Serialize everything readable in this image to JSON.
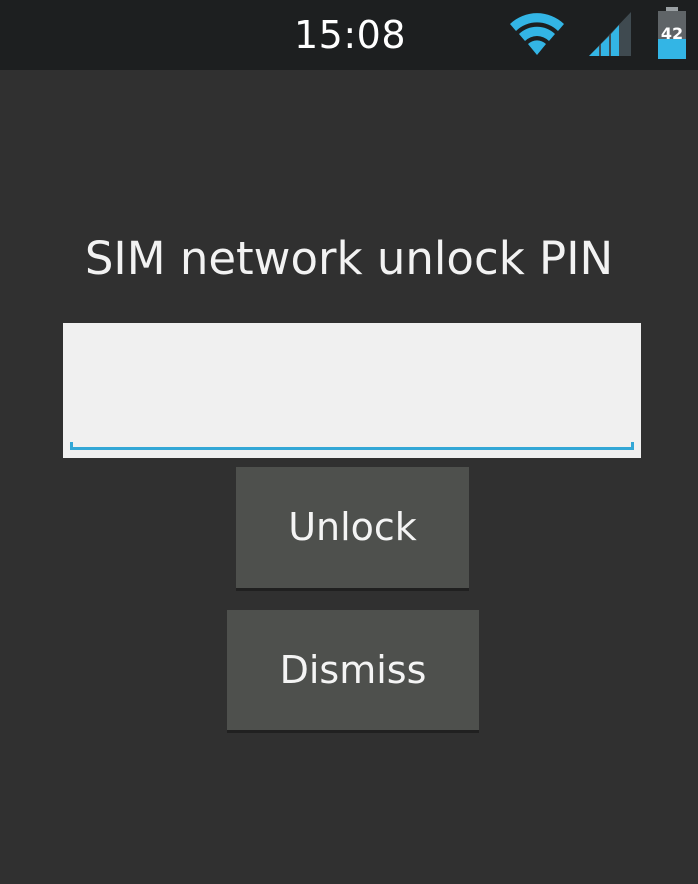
{
  "status_bar": {
    "time": "15:08",
    "battery_level": "42",
    "icons": [
      "wifi-icon",
      "signal-icon",
      "battery-icon"
    ],
    "icon_color": "#33b5e5"
  },
  "unlock_screen": {
    "prompt": "SIM network unlock PIN",
    "pin_input": {
      "value": "",
      "placeholder": ""
    },
    "unlock_label": "Unlock",
    "dismiss_label": "Dismiss"
  },
  "colors": {
    "background": "#303030",
    "status_bar": "#1d1f20",
    "button": "#4e504d",
    "accent": "#33a7d6",
    "input_background": "#f0f0f0"
  }
}
